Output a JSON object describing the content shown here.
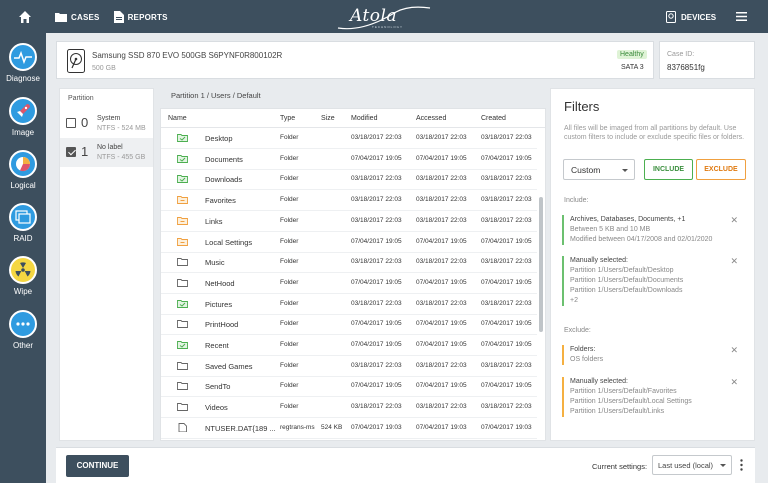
{
  "topbar": {
    "cases_label": "CASES",
    "reports_label": "REPORTS",
    "logo_text": "Atola",
    "logo_sub": "TECHNOLOGY",
    "devices_label": "DEVICES"
  },
  "rail": [
    {
      "label": "Diagnose"
    },
    {
      "label": "Image"
    },
    {
      "label": "Logical"
    },
    {
      "label": "RAID"
    },
    {
      "label": "Wipe"
    },
    {
      "label": "Other"
    }
  ],
  "device": {
    "name": "Samsung SSD 870 EVO 500GB S6PYNF0R800102R",
    "size": "500 GB",
    "status": "Healthy",
    "interface": "SATA 3",
    "case_id_label": "Case ID:",
    "case_id": "8376851fg"
  },
  "partitions": {
    "title": "Partition",
    "items": [
      {
        "num": "0",
        "name": "System",
        "desc": "NTFS - 524 MB",
        "checked": false
      },
      {
        "num": "1",
        "name": "No label",
        "desc": "NTFS - 455 GB",
        "checked": true
      }
    ]
  },
  "breadcrumb": "Partition 1 / Users / Default",
  "table": {
    "headers": {
      "name": "Name",
      "type": "Type",
      "size": "Size",
      "modified": "Modified",
      "accessed": "Accessed",
      "created": "Created"
    },
    "rows": [
      {
        "name": "Desktop",
        "type": "Folder",
        "size": "",
        "modified": "03/18/2017 22:03",
        "accessed": "03/18/2017 22:03",
        "created": "03/18/2017 22:03",
        "icon": "folder-included"
      },
      {
        "name": "Documents",
        "type": "Folder",
        "size": "",
        "modified": "07/04/2017 19:05",
        "accessed": "07/04/2017 19:05",
        "created": "07/04/2017 19:05",
        "icon": "folder-included"
      },
      {
        "name": "Downloads",
        "type": "Folder",
        "size": "",
        "modified": "03/18/2017 22:03",
        "accessed": "03/18/2017 22:03",
        "created": "03/18/2017 22:03",
        "icon": "folder-included"
      },
      {
        "name": "Favorites",
        "type": "Folder",
        "size": "",
        "modified": "03/18/2017 22:03",
        "accessed": "03/18/2017 22:03",
        "created": "03/18/2017 22:03",
        "icon": "folder-excluded"
      },
      {
        "name": "Links",
        "type": "Folder",
        "size": "",
        "modified": "03/18/2017 22:03",
        "accessed": "03/18/2017 22:03",
        "created": "03/18/2017 22:03",
        "icon": "folder-excluded"
      },
      {
        "name": "Local Settings",
        "type": "Folder",
        "size": "",
        "modified": "07/04/2017 19:05",
        "accessed": "07/04/2017 19:05",
        "created": "07/04/2017 19:05",
        "icon": "folder-excluded"
      },
      {
        "name": "Music",
        "type": "Folder",
        "size": "",
        "modified": "03/18/2017 22:03",
        "accessed": "03/18/2017 22:03",
        "created": "03/18/2017 22:03",
        "icon": "folder"
      },
      {
        "name": "NetHood",
        "type": "Folder",
        "size": "",
        "modified": "07/04/2017 19:05",
        "accessed": "07/04/2017 19:05",
        "created": "07/04/2017 19:05",
        "icon": "folder"
      },
      {
        "name": "Pictures",
        "type": "Folder",
        "size": "",
        "modified": "03/18/2017 22:03",
        "accessed": "03/18/2017 22:03",
        "created": "03/18/2017 22:03",
        "icon": "folder-included"
      },
      {
        "name": "PrintHood",
        "type": "Folder",
        "size": "",
        "modified": "07/04/2017 19:05",
        "accessed": "07/04/2017 19:05",
        "created": "07/04/2017 19:05",
        "icon": "folder"
      },
      {
        "name": "Recent",
        "type": "Folder",
        "size": "",
        "modified": "07/04/2017 19:05",
        "accessed": "07/04/2017 19:05",
        "created": "07/04/2017 19:05",
        "icon": "folder-included"
      },
      {
        "name": "Saved Games",
        "type": "Folder",
        "size": "",
        "modified": "03/18/2017 22:03",
        "accessed": "03/18/2017 22:03",
        "created": "03/18/2017 22:03",
        "icon": "folder"
      },
      {
        "name": "SendTo",
        "type": "Folder",
        "size": "",
        "modified": "07/04/2017 19:05",
        "accessed": "07/04/2017 19:05",
        "created": "07/04/2017 19:05",
        "icon": "folder"
      },
      {
        "name": "Videos",
        "type": "Folder",
        "size": "",
        "modified": "03/18/2017 22:03",
        "accessed": "03/18/2017 22:03",
        "created": "03/18/2017 22:03",
        "icon": "folder"
      },
      {
        "name": "NTUSER.DAT{189 ...",
        "type": "regtrans-ms",
        "size": "524 KB",
        "modified": "07/04/2017 19:03",
        "accessed": "07/04/2017 19:03",
        "created": "07/04/2017 19:03",
        "icon": "file"
      }
    ]
  },
  "filters": {
    "title": "Filters",
    "description": "All files will be imaged from all partitions by default. Use custom filters to include or exclude specific files or folders.",
    "mode": "Custom",
    "include_button": "INCLUDE",
    "exclude_button": "EXCLUDE",
    "include_heading": "Include:",
    "include_rules": [
      {
        "title": "Archives, Databases, Documents, +1",
        "lines": [
          "Between 5 KB and 10 MB",
          "Modified between 04/17/2008 and 02/01/2020"
        ]
      },
      {
        "title": "Manually selected:",
        "lines": [
          "Partition 1/Users/Default/Desktop",
          "Partition 1/Users/Default/Documents",
          "Partition 1/Users/Default/Downloads",
          "+2"
        ]
      }
    ],
    "exclude_heading": "Exclude:",
    "exclude_rules": [
      {
        "title": "Folders:",
        "lines": [
          "OS folders"
        ]
      },
      {
        "title": "Manually selected:",
        "lines": [
          "Partition 1/Users/Default/Favorites",
          "Partition 1/Users/Default/Local Settings",
          "Partition 1/Users/Default/Links"
        ]
      }
    ],
    "remove_glyph": "✕"
  },
  "footer": {
    "continue_label": "CONTINUE",
    "current_settings_label": "Current settings:",
    "current_settings_value": "Last used (local)"
  },
  "colors": {
    "chrome": "#3d4f5e",
    "rail_accent": "#2f9be0",
    "include_green": "#4caf50",
    "exclude_orange": "#f0a040"
  }
}
